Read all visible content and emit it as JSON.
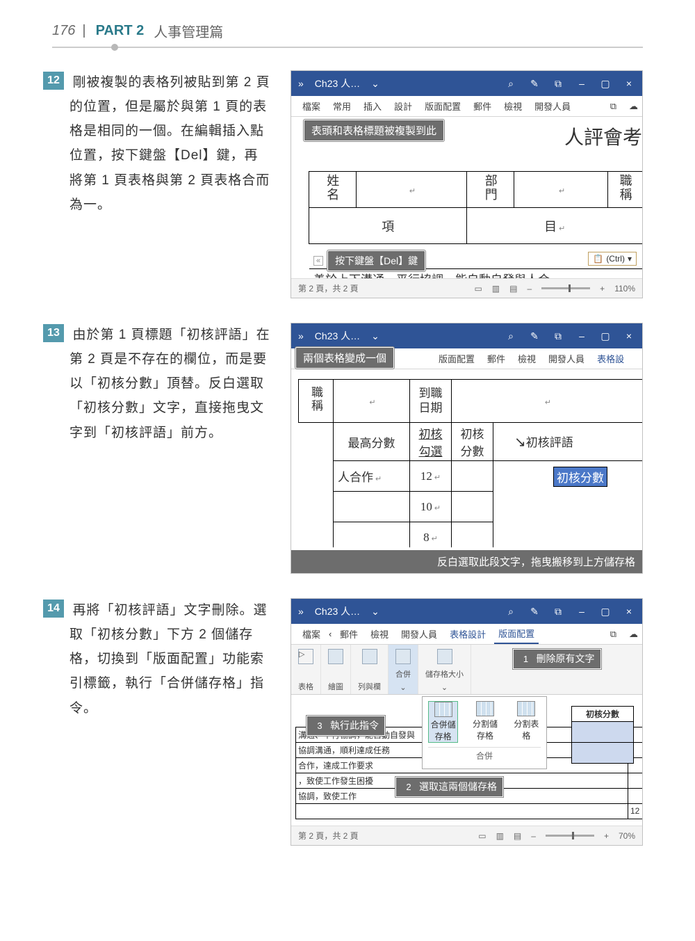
{
  "header": {
    "pageNumber": "176",
    "sep": "|",
    "part": "PART 2",
    "title": "人事管理篇"
  },
  "steps": [
    {
      "num": "12",
      "body": "剛被複製的表格列被貼到第 2 頁的位置，但是屬於與第 1 頁的表格是相同的一個。在編輯插入點位置，按下鍵盤【Del】鍵，再將第 1 頁表格與第 2 頁表格合而為一。"
    },
    {
      "num": "13",
      "body": "由於第 1 頁標題「初核評語」在第 2 頁是不存在的欄位，而是要以「初核分數」頂替。反白選取「初核分數」文字，直接拖曳文字到「初核評語」前方。"
    },
    {
      "num": "14",
      "body": "再將「初核評語」文字刪除。選取「初核分數」下方 2 個儲存格，切換到「版面配置」功能索引標籤，執行「合併儲存格」指令。"
    }
  ],
  "word_common": {
    "doc_title": "Ch23 人…",
    "chev": "⌄",
    "search": "⌕",
    "pen": "✎",
    "box": "⧉",
    "min": "–",
    "max": "▢",
    "close": "×"
  },
  "ribbon1": {
    "tabs": [
      "檔案",
      "常用",
      "插入",
      "設計",
      "版面配置",
      "郵件",
      "檢視",
      "開發人員"
    ],
    "msg": "⧉",
    "share": "☁"
  },
  "shot1": {
    "callout1": "表頭和表格標題被複製到此",
    "doc_heading": "人評會考",
    "name_h": "姓名",
    "dept_h": "部門",
    "pos_h": "職稱",
    "item_h": "項",
    "mu_h": "目",
    "callout2": "按下鍵盤【Del】鍵",
    "ctrl": "(Ctrl)",
    "ctrl_icon": "📋",
    "footnote": "善於上下溝通、平行協調，能自動自發與人合",
    "status_page": "第 2 頁，共 2 頁",
    "status_zoom": "110%"
  },
  "ribbon2": {
    "callout": "兩個表格變成一個",
    "tabs_right": [
      "版面配置",
      "郵件",
      "檢視",
      "開發人員",
      "表格設"
    ]
  },
  "shot2": {
    "pos_h": "職稱",
    "date_h": "到職日期",
    "max_h": "最高分數",
    "chk_h": "初核勾選",
    "score_h": "初核分數",
    "eval_h": "初核評語",
    "row1": "人合作",
    "v1": "12",
    "sel_text": "初核分數",
    "v2": "10",
    "v3": "8",
    "footer": "反白選取此段文字，拖曳搬移到上方儲存格"
  },
  "ribbon3": {
    "tabs": [
      "檔案",
      "郵件",
      "檢視",
      "開發人員",
      "表格設計",
      "版面配置"
    ],
    "active": "版面配置",
    "groups": [
      "表格",
      "繪圖",
      "列與欄",
      "合併",
      "儲存格大小"
    ],
    "merge_cells": "合併儲存格",
    "split_cells": "分割儲存格",
    "split_table": "分割表格",
    "merge_label": "合併"
  },
  "shot3": {
    "callout1": {
      "num": "1",
      "text": "刪除原有文字"
    },
    "callout2": {
      "num": "2",
      "text": "選取這兩個儲存格"
    },
    "callout3": {
      "num": "3",
      "text": "執行此指令"
    },
    "right_header": "初核分數",
    "rows": [
      "溝通、平行協調，能自動自發與",
      "協調溝通，順利達成任務",
      "合作，達成工作要求",
      "，致使工作發生困擾",
      "協調，致使工作"
    ],
    "nums": [
      "",
      "",
      "",
      "",
      "",
      "12"
    ],
    "status_page": "第 2 頁，共 2 頁",
    "status_zoom": "70%"
  }
}
